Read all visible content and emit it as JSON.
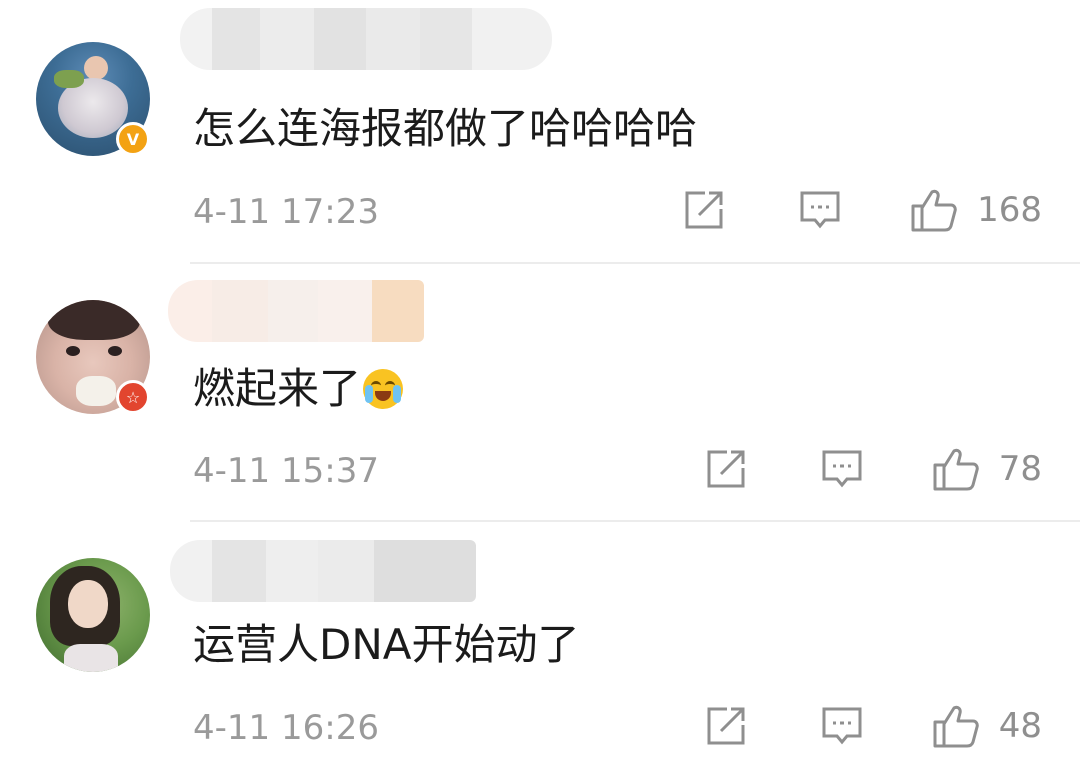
{
  "comments": [
    {
      "text": "怎么连海报都做了哈哈哈哈",
      "time": "4-11 17:23",
      "likes": "168",
      "avatar_icon": "avatar-sea-dress",
      "badge_icon": "verified-v-badge",
      "badge_label": "V",
      "badge_color": "#f3a213"
    },
    {
      "text": "燃起来了",
      "emoji": "laugh-cry-emoji",
      "time": "4-11 15:37",
      "likes": "78",
      "avatar_icon": "avatar-girl-mask",
      "badge_icon": "star-badge",
      "badge_label": "☆",
      "badge_color": "#e2452f"
    },
    {
      "text": "运营人DNA开始动了",
      "time": "4-11 16:26",
      "likes": "48",
      "avatar_icon": "avatar-girl-grass"
    }
  ],
  "icons": {
    "share": "share-icon",
    "reply": "comment-icon",
    "like": "thumbs-up-icon"
  },
  "colors": {
    "text": "#1b1b1b",
    "meta": "#9a9a9a",
    "divider": "#ececec"
  }
}
